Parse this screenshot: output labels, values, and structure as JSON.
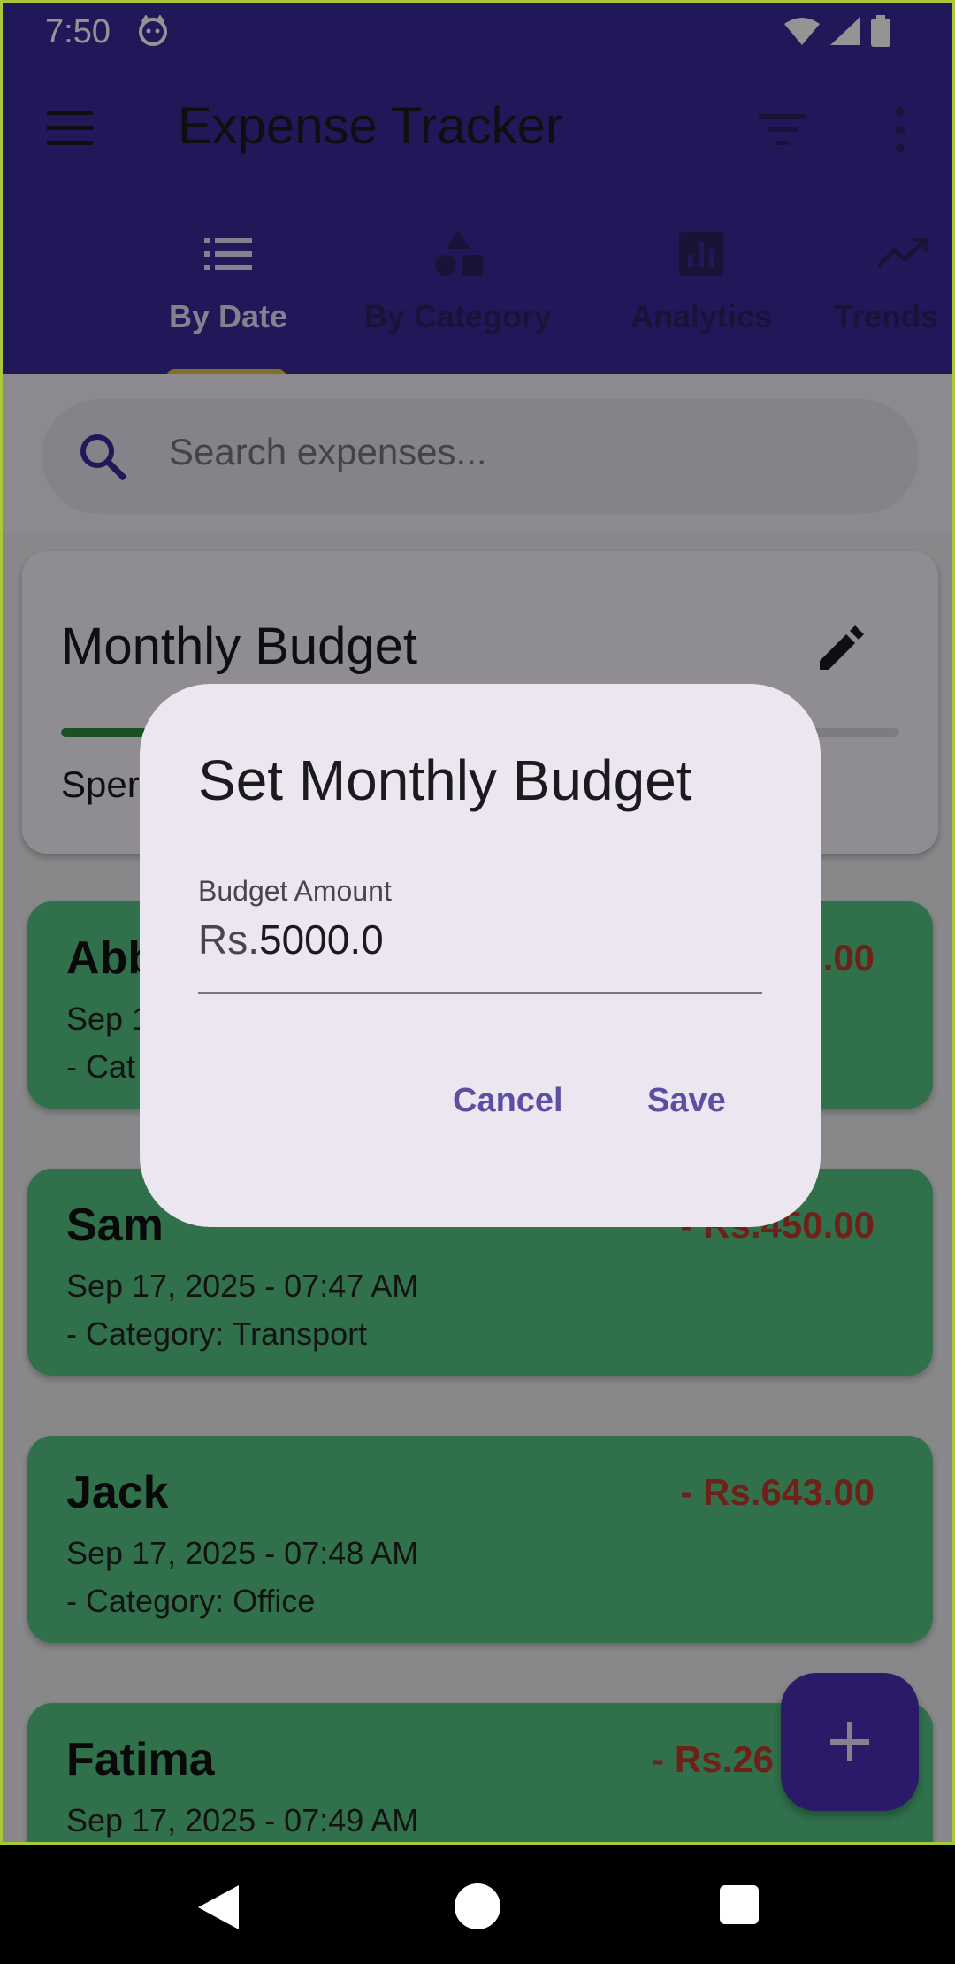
{
  "status_bar": {
    "time": "7:50"
  },
  "app_bar": {
    "title": "Expense Tracker"
  },
  "tabs": [
    {
      "label": "By Date",
      "icon": "list-icon",
      "active": true
    },
    {
      "label": "By Category",
      "icon": "category-icon",
      "active": false
    },
    {
      "label": "Analytics",
      "icon": "analytics-icon",
      "active": false
    },
    {
      "label": "Trends",
      "icon": "trending-up-icon",
      "active": false
    }
  ],
  "search": {
    "placeholder": "Search expenses..."
  },
  "budget_card": {
    "title": "Monthly Budget",
    "spent_label": "Sper"
  },
  "expenses": [
    {
      "name": "Abb",
      "amount": ".00",
      "date": "Sep 1",
      "category": "- Cat"
    },
    {
      "name": "Sam",
      "amount": "- Rs.450.00",
      "date": "Sep 17, 2025 - 07:47 AM",
      "category": "- Category: Transport"
    },
    {
      "name": "Jack",
      "amount": "- Rs.643.00",
      "date": "Sep 17, 2025 - 07:48 AM",
      "category": "- Category: Office"
    },
    {
      "name": "Fatima",
      "amount": "- Rs.26",
      "date": "Sep 17, 2025 - 07:49 AM",
      "category": ""
    }
  ],
  "dialog": {
    "title": "Set Monthly Budget",
    "field_label": "Budget Amount",
    "prefix": "Rs.",
    "value": "5000.0",
    "cancel_label": "Cancel",
    "save_label": "Save"
  },
  "colors": {
    "app_bar": "#3a2a9c",
    "expense_card": "#54c384",
    "expense_amount": "#c0392b",
    "dialog_background": "#ece6f0",
    "dialog_button": "#5b4fa3",
    "fab": "#4a2db4"
  }
}
